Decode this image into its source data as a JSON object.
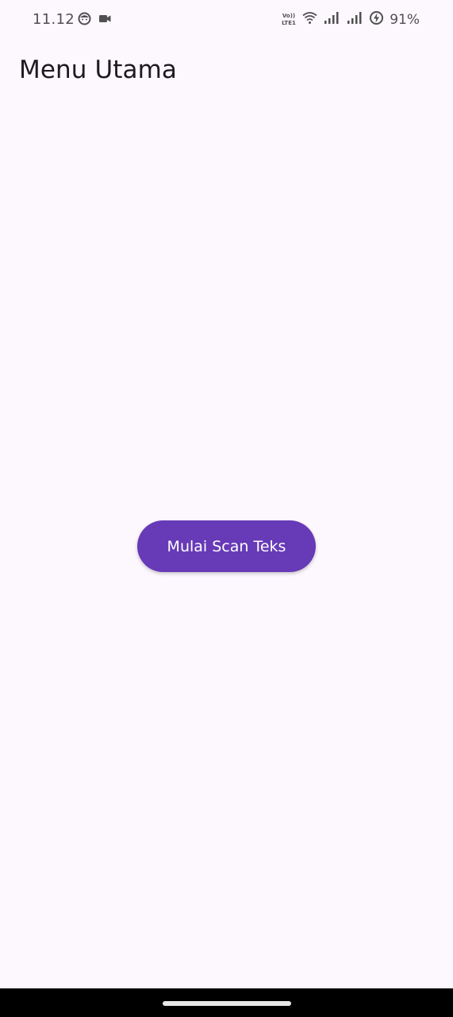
{
  "status_bar": {
    "time": "11.12",
    "battery_percent": "91%",
    "network_label": "Vo)) LTE1",
    "left_icons": [
      "face-notification-icon",
      "video-camera-icon"
    ],
    "right_icons": [
      "volte-icon",
      "wifi-icon",
      "signal-sim1-icon",
      "signal-sim2-icon",
      "battery-charging-icon"
    ]
  },
  "app_bar": {
    "title": "Menu Utama"
  },
  "main": {
    "scan_button_label": "Mulai Scan Teks"
  },
  "colors": {
    "background": "#fdf7fe",
    "primary": "#673ab7",
    "on_primary": "#ffffff",
    "title_text": "#1d1b20",
    "nav_bar": "#000000"
  }
}
